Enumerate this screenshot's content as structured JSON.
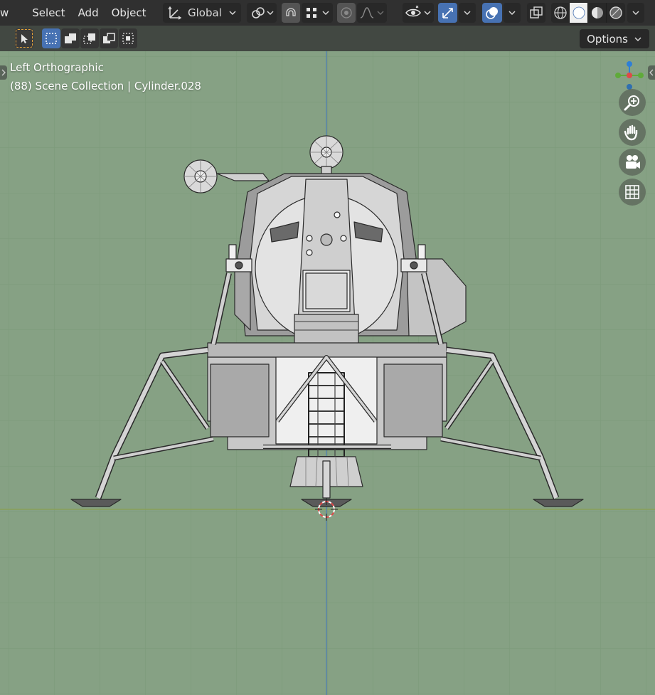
{
  "header": {
    "menu_cut": "w",
    "menu": [
      "Select",
      "Add",
      "Object"
    ],
    "transform_orientation": "Global"
  },
  "toolbar": {
    "options_label": "Options"
  },
  "viewport": {
    "view_name": "Left Orthographic",
    "collection_info": "(88) Scene Collection | Cylinder.028",
    "background_color": "#86a184",
    "grid_color": "#7c9a7a",
    "axis_x_color": "#8aa14f",
    "axis_z_color": "#4f7fb0"
  },
  "gizmo": {
    "z_color": "#2f7fd6",
    "x_color": "#e04848",
    "y_color": "#5faa3a"
  },
  "nav_buttons": [
    "zoom-icon",
    "hand-pan-icon",
    "camera-icon",
    "grid-toggle-icon"
  ],
  "shading_mode_active": "solid"
}
